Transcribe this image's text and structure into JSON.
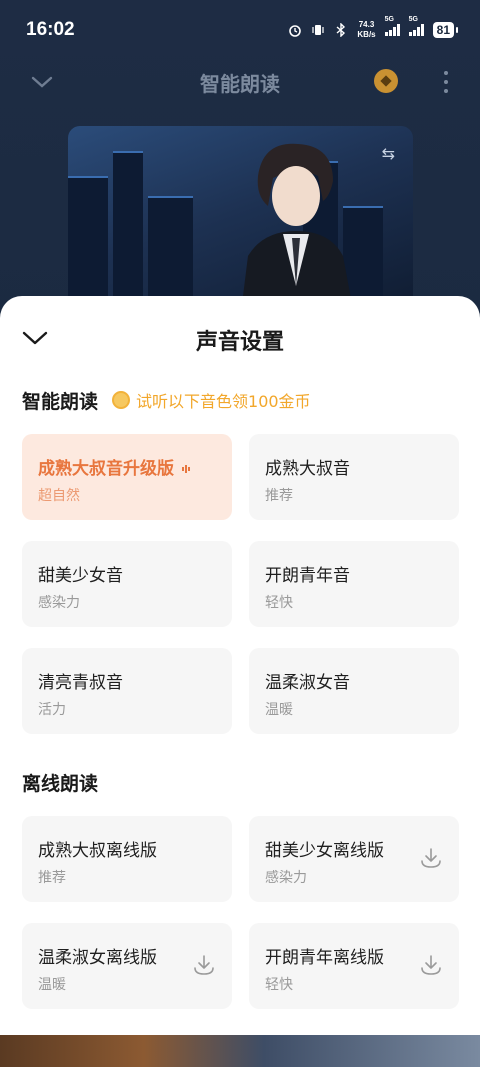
{
  "status_bar": {
    "time": "16:02",
    "net_speed_value": "74.3",
    "net_speed_unit": "KB/s",
    "sim1": "5G",
    "sim2": "5G",
    "battery": "81"
  },
  "player": {
    "title": "智能朗读"
  },
  "sheet": {
    "title": "声音设置",
    "smart_section": {
      "title": "智能朗读",
      "promo": "试听以下音色领100金币",
      "voices": [
        {
          "name": "成熟大叔音升级版",
          "tag": "超自然",
          "selected": true
        },
        {
          "name": "成熟大叔音",
          "tag": "推荐",
          "selected": false
        },
        {
          "name": "甜美少女音",
          "tag": "感染力",
          "selected": false
        },
        {
          "name": "开朗青年音",
          "tag": "轻快",
          "selected": false
        },
        {
          "name": "清亮青叔音",
          "tag": "活力",
          "selected": false
        },
        {
          "name": "温柔淑女音",
          "tag": "温暖",
          "selected": false
        }
      ]
    },
    "offline_section": {
      "title": "离线朗读",
      "voices": [
        {
          "name": "成熟大叔离线版",
          "tag": "推荐",
          "downloadable": false
        },
        {
          "name": "甜美少女离线版",
          "tag": "感染力",
          "downloadable": true
        },
        {
          "name": "温柔淑女离线版",
          "tag": "温暖",
          "downloadable": true
        },
        {
          "name": "开朗青年离线版",
          "tag": "轻快",
          "downloadable": true
        }
      ]
    }
  },
  "colors": {
    "accent": "#e8763e",
    "promo": "#f2a72b",
    "selected_bg": "#fde9df",
    "card_bg": "#f6f6f6"
  }
}
